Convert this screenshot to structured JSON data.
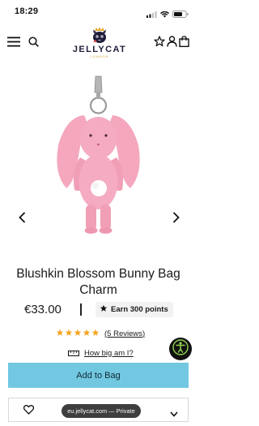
{
  "status_bar": {
    "time": "18:29"
  },
  "header": {
    "logo_text": "JELLYCAT",
    "logo_subtext": "LONDON",
    "icons": [
      "menu-icon",
      "search-icon",
      "star-icon",
      "account-icon",
      "bag-icon"
    ]
  },
  "product": {
    "title": "Blushkin Blossom Bunny Bag Charm",
    "price": "€33.00",
    "points": "Earn 300 points",
    "rating_stars": 5,
    "reviews_text": "(5 Reviews)",
    "size_guide": "How big am I?"
  },
  "actions": {
    "add_to_bag": "Add to Bag"
  },
  "browser": {
    "url_pill": "eu.jellycat.com — Private"
  },
  "colors": {
    "add_to_bag_bg": "#72c8e1",
    "star": "#f5a623",
    "bunny_pink": "#f4a7bd"
  }
}
